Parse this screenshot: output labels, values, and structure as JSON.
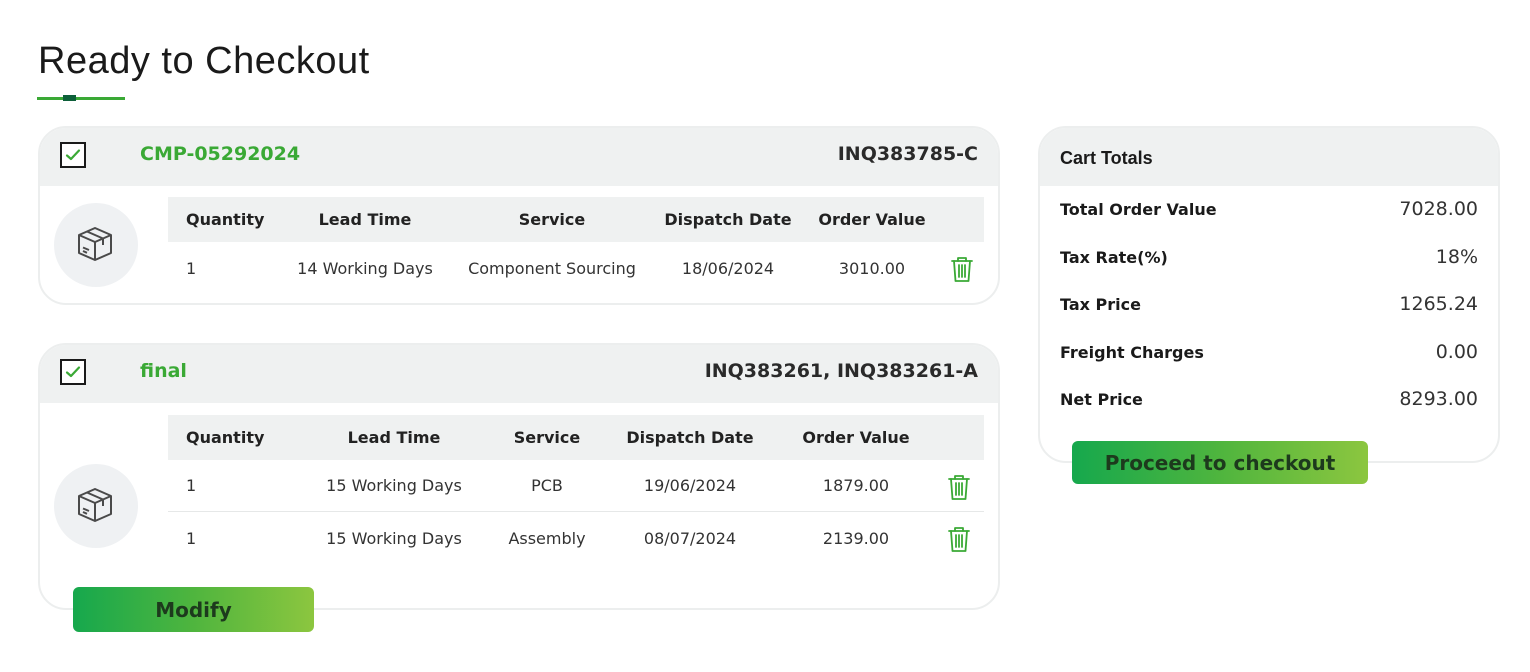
{
  "page": {
    "title": "Ready to Checkout"
  },
  "table_headers": {
    "quantity": "Quantity",
    "lead_time": "Lead Time",
    "service": "Service",
    "dispatch_date": "Dispatch Date",
    "order_value": "Order Value"
  },
  "orders": [
    {
      "checked": true,
      "project_name": "CMP-05292024",
      "inquiry_ids": "INQ383785-C",
      "rows": [
        {
          "quantity": "1",
          "lead_time": "14 Working Days",
          "service": "Component Sourcing",
          "dispatch_date": "18/06/2024",
          "order_value": "3010.00"
        }
      ]
    },
    {
      "checked": true,
      "project_name": "final",
      "inquiry_ids": "INQ383261, INQ383261-A",
      "rows": [
        {
          "quantity": "1",
          "lead_time": "15 Working Days",
          "service": "PCB",
          "dispatch_date": "19/06/2024",
          "order_value": "1879.00"
        },
        {
          "quantity": "1",
          "lead_time": "15 Working Days",
          "service": "Assembly",
          "dispatch_date": "08/07/2024",
          "order_value": "2139.00"
        }
      ],
      "modify_label": "Modify"
    }
  ],
  "cart_totals": {
    "title": "Cart Totals",
    "rows": [
      {
        "label": "Total Order Value",
        "value": "7028.00"
      },
      {
        "label": "Tax Rate(%)",
        "value": "18%"
      },
      {
        "label": "Tax Price",
        "value": "1265.24"
      },
      {
        "label": "Freight Charges",
        "value": "0.00"
      },
      {
        "label": "Net Price",
        "value": "8293.00"
      }
    ],
    "checkout_label": "Proceed to checkout"
  },
  "icons": {
    "checkbox": "checkmark-icon",
    "product": "package-box-icon",
    "delete": "trash-icon"
  },
  "colors": {
    "accent_green": "#3aa935",
    "dark_green": "#0d5f3a",
    "button_gradient_start": "#16a84d",
    "button_gradient_end": "#8cc63f",
    "header_bg": "#eff1f1"
  }
}
